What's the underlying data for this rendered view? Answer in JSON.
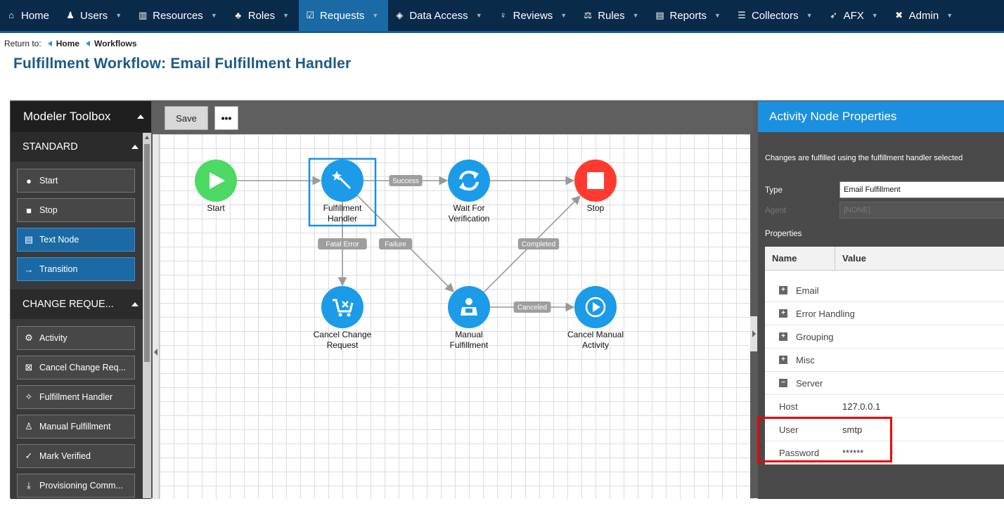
{
  "nav": {
    "items": [
      {
        "label": "Home",
        "icon": "home-icon",
        "glyph": "⌂",
        "caret": false,
        "active": false
      },
      {
        "label": "Users",
        "icon": "users-icon",
        "glyph": "♟",
        "caret": true,
        "active": false
      },
      {
        "label": "Resources",
        "icon": "bank-icon",
        "glyph": "▥",
        "caret": true,
        "active": false
      },
      {
        "label": "Roles",
        "icon": "sitemap-icon",
        "glyph": "♣",
        "caret": true,
        "active": false
      },
      {
        "label": "Requests",
        "icon": "clipboard-check-icon",
        "glyph": "☑",
        "caret": true,
        "active": true
      },
      {
        "label": "Data Access",
        "icon": "layers-icon",
        "glyph": "◈",
        "caret": true,
        "active": false
      },
      {
        "label": "Reviews",
        "icon": "lightbulb-icon",
        "glyph": "♀",
        "caret": true,
        "active": false
      },
      {
        "label": "Rules",
        "icon": "scale-icon",
        "glyph": "⚖",
        "caret": true,
        "active": false
      },
      {
        "label": "Reports",
        "icon": "chart-icon",
        "glyph": "▤",
        "caret": true,
        "active": false
      },
      {
        "label": "Collectors",
        "icon": "database-icon",
        "glyph": "☰",
        "caret": true,
        "active": false
      },
      {
        "label": "AFX",
        "icon": "rocket-icon",
        "glyph": "➶",
        "caret": true,
        "active": false
      },
      {
        "label": "Admin",
        "icon": "tools-icon",
        "glyph": "✖",
        "caret": true,
        "active": false
      }
    ]
  },
  "breadcrumb": {
    "prefix": "Return to:",
    "items": [
      "Home",
      "Workflows"
    ]
  },
  "page": {
    "title": "Fulfillment Workflow: Email Fulfillment Handler"
  },
  "toolbox": {
    "title": "Modeler Toolbox",
    "sections": [
      {
        "title": "STANDARD",
        "items": [
          {
            "label": "Start",
            "icon": "circle-icon",
            "glyph": "●",
            "blue": false
          },
          {
            "label": "Stop",
            "icon": "square-icon",
            "glyph": "■",
            "blue": false
          },
          {
            "label": "Text Node",
            "icon": "document-icon",
            "glyph": "▤",
            "blue": true
          },
          {
            "label": "Transition",
            "icon": "arrow-right-icon",
            "glyph": "→",
            "blue": true
          }
        ]
      },
      {
        "title": "CHANGE REQUE...",
        "items": [
          {
            "label": "Activity",
            "icon": "gears-icon",
            "glyph": "⚙",
            "blue": false
          },
          {
            "label": "Cancel Change Req...",
            "icon": "cart-x-icon",
            "glyph": "⊠",
            "blue": false
          },
          {
            "label": "Fulfillment Handler",
            "icon": "magic-wand-icon",
            "glyph": "✧",
            "blue": false
          },
          {
            "label": "Manual Fulfillment",
            "icon": "user-box-icon",
            "glyph": "♙",
            "blue": false
          },
          {
            "label": "Mark Verified",
            "icon": "check-circle-icon",
            "glyph": "✓",
            "blue": false
          },
          {
            "label": "Provisioning Comm...",
            "icon": "download-icon",
            "glyph": "⤓",
            "blue": false
          }
        ]
      }
    ]
  },
  "canvas": {
    "save_label": "Save",
    "more_label": "•••",
    "nodes": [
      {
        "id": "start",
        "line1": "Start",
        "line2": "",
        "color": "#4cd964",
        "icon": "play-icon"
      },
      {
        "id": "fulfillment",
        "line1": "Fulfillment",
        "line2": "Handler",
        "color": "#1b9be8",
        "icon": "magic-wand-icon"
      },
      {
        "id": "wait",
        "line1": "Wait For",
        "line2": "Verification",
        "color": "#1b9be8",
        "icon": "refresh-icon"
      },
      {
        "id": "stop",
        "line1": "Stop",
        "line2": "",
        "color": "#ff3b30",
        "icon": "stop-icon"
      },
      {
        "id": "cancelchange",
        "line1": "Cancel Change",
        "line2": "Request",
        "color": "#1b9be8",
        "icon": "cart-x-icon"
      },
      {
        "id": "manual",
        "line1": "Manual",
        "line2": "Fulfillment",
        "color": "#1b9be8",
        "icon": "user-box-icon"
      },
      {
        "id": "cancelmanual",
        "line1": "Cancel Manual",
        "line2": "Activity",
        "color": "#1b9be8",
        "icon": "play-circle-icon"
      }
    ],
    "edges": [
      {
        "from": "start",
        "to": "fulfillment",
        "label": ""
      },
      {
        "from": "fulfillment",
        "to": "wait",
        "label": "Success"
      },
      {
        "from": "wait",
        "to": "stop",
        "label": ""
      },
      {
        "from": "fulfillment",
        "to": "cancelchange",
        "label": "Fatal Error"
      },
      {
        "from": "fulfillment",
        "to": "manual",
        "label": "Failure"
      },
      {
        "from": "manual",
        "to": "stop",
        "label": "Completed"
      },
      {
        "from": "manual",
        "to": "cancelmanual",
        "label": "Canceled"
      }
    ],
    "selected_node": "fulfillment"
  },
  "properties": {
    "title": "Activity Node Properties",
    "description": "Changes are fulfilled using the fulfillment handler selected",
    "type_label": "Type",
    "type_value": "Email Fulfillment",
    "agent_label": "Agent",
    "agent_value": "[NONE]",
    "properties_label": "Properties",
    "col_name": "Name",
    "col_value": "Value",
    "groups": [
      "Email",
      "Error Handling",
      "Grouping",
      "Misc"
    ],
    "open_group": "Server",
    "fields": [
      {
        "name": "Host",
        "value": "127.0.0.1"
      },
      {
        "name": "User",
        "value": "smtp"
      },
      {
        "name": "Password",
        "value": "******"
      }
    ]
  }
}
